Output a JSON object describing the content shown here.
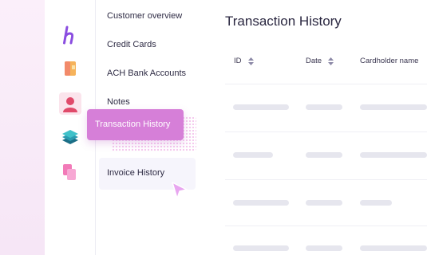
{
  "sidebar": {
    "items": [
      {
        "label": "Customer overview"
      },
      {
        "label": "Credit Cards"
      },
      {
        "label": "ACH Bank Accounts"
      },
      {
        "label": "Notes"
      },
      {
        "label": "Invoice History"
      }
    ],
    "dragging_item": {
      "label": "Transaction History"
    }
  },
  "rail_icons": [
    "brand-logo-icon",
    "document-icon",
    "user-icon",
    "layers-icon",
    "copy-icon"
  ],
  "main": {
    "title": "Transaction History",
    "columns": [
      {
        "label": "ID"
      },
      {
        "label": "Date"
      },
      {
        "label": "Cardholder name"
      }
    ]
  },
  "colors": {
    "accent": "#d67fd8",
    "brand": "#8a4de0",
    "text": "#2a2740",
    "skeleton": "#e6e6ee"
  }
}
